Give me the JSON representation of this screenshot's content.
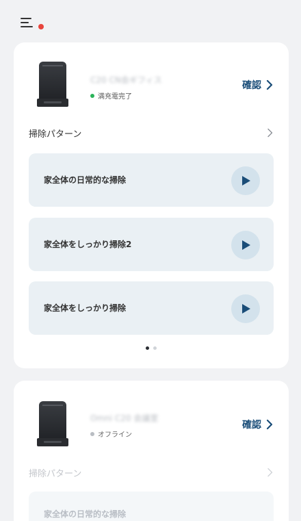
{
  "devices": [
    {
      "name": "C20 CN会ギフィス",
      "status": "満充電完了",
      "confirm_label": "確認",
      "pattern_label": "掃除パターン",
      "plans": [
        {
          "label": "家全体の日常的な掃除"
        },
        {
          "label": "家全体をしっかり掃除2"
        },
        {
          "label": "家全体をしっかり掃除"
        }
      ],
      "page_count": 2,
      "active_page": 1
    },
    {
      "name": "Omni C20 会議室",
      "status": "オフライン",
      "confirm_label": "確認",
      "pattern_label": "掃除パターン",
      "plans": [
        {
          "label": "家全体の日常的な掃除"
        }
      ]
    }
  ],
  "colors": {
    "accent": "#1a4d78",
    "status_online": "#2bb35a",
    "status_offline": "#b9bdc3",
    "notification": "#e8453c"
  },
  "icons": {
    "menu": "hamburger-menu-icon",
    "play": "play-icon",
    "chevron": "chevron-right-icon"
  }
}
